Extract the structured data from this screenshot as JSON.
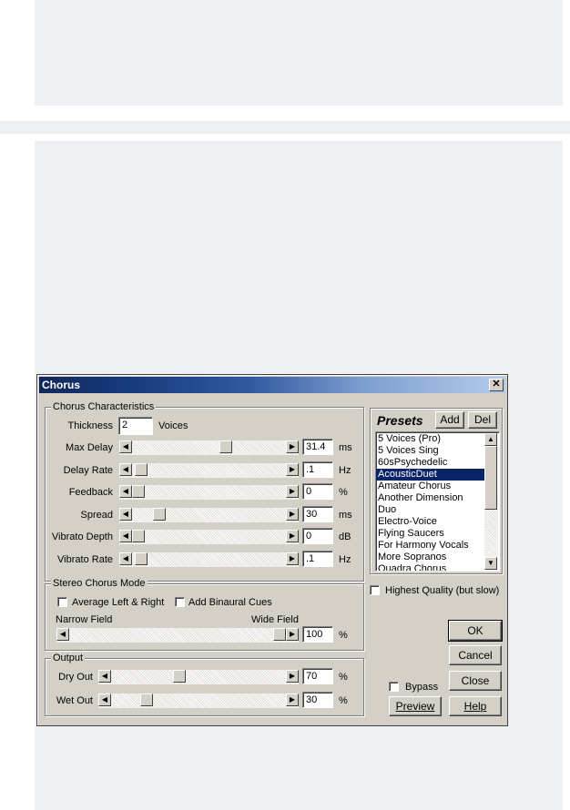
{
  "dialog": {
    "title": "Chorus",
    "close_glyph": "✕"
  },
  "characteristics": {
    "group_label": "Chorus Characteristics",
    "thickness": {
      "label": "Thickness",
      "value": "2",
      "unit": "Voices"
    },
    "rows": [
      {
        "label": "Max Delay",
        "value": "31.4",
        "unit": "ms",
        "level": 0.62
      },
      {
        "label": "Delay Rate",
        "value": ".1",
        "unit": "Hz",
        "level": 0.02
      },
      {
        "label": "Feedback",
        "value": "0",
        "unit": "%",
        "level": 0.0
      },
      {
        "label": "Spread",
        "value": "30",
        "unit": "ms",
        "level": 0.15
      },
      {
        "label": "Vibrato Depth",
        "value": "0",
        "unit": "dB",
        "level": 0.0
      },
      {
        "label": "Vibrato Rate",
        "value": ".1",
        "unit": "Hz",
        "level": 0.02
      }
    ]
  },
  "presets": {
    "label": "Presets",
    "add_label": "Add",
    "del_label": "Del",
    "items": [
      "5 Voices (Pro)",
      "5 Voices Sing",
      "60sPsychedelic",
      "AcousticDuet",
      "Amateur Chorus",
      "Another Dimension",
      "Duo",
      "Electro-Voice",
      "Flying Saucers",
      "For Harmony Vocals",
      "More Sopranos",
      "Quadra Chorus"
    ],
    "selected_index": 3
  },
  "stereo": {
    "group_label": "Stereo Chorus Mode",
    "avg_label": "Average Left & Right",
    "binaural_label": "Add Binaural Cues",
    "narrow_label": "Narrow Field",
    "wide_label": "Wide Field",
    "value": "100",
    "unit": "%",
    "level": 1.0
  },
  "highest_quality_label": "Highest Quality (but slow)",
  "output": {
    "group_label": "Output",
    "dry": {
      "label": "Dry Out",
      "value": "70",
      "unit": "%",
      "level": 0.38
    },
    "wet": {
      "label": "Wet Out",
      "value": "30",
      "unit": "%",
      "level": 0.18
    }
  },
  "buttons": {
    "ok": "OK",
    "cancel": "Cancel",
    "close": "Close",
    "help": "Help",
    "preview": "Preview",
    "bypass": "Bypass"
  },
  "colors": {
    "title_dark": "#12285c",
    "title_light": "#b3cbed",
    "selection": "#0a246a",
    "face": "#d4d0c8"
  }
}
